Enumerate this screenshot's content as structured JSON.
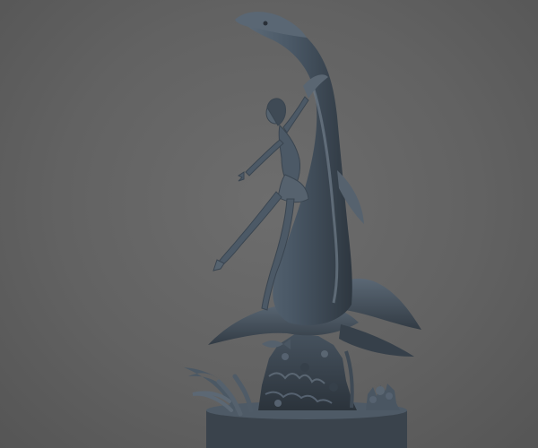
{
  "viewport": {
    "background": "#666666",
    "model": {
      "subject": "sculpt-preview",
      "material_color": "#4a5866",
      "highlight_color": "#7f8c99",
      "shadow_color": "#2c343c"
    }
  }
}
